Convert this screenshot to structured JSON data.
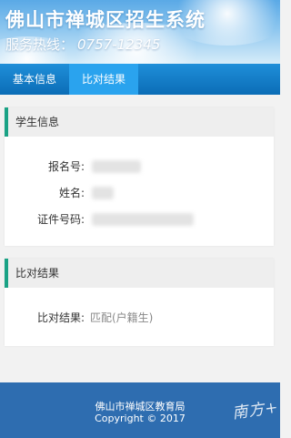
{
  "header": {
    "title": "佛山市禅城区招生系统",
    "hotline_label": "服务热线：",
    "hotline_number": "0757-12345"
  },
  "tabs": [
    {
      "label": "基本信息",
      "active": false
    },
    {
      "label": "比对结果",
      "active": true
    }
  ],
  "student_info": {
    "heading": "学生信息",
    "fields": [
      {
        "label": "报名号:",
        "value": ""
      },
      {
        "label": "姓名:",
        "value": ""
      },
      {
        "label": "证件号码:",
        "value": ""
      }
    ]
  },
  "compare": {
    "heading": "比对结果",
    "label": "比对结果:",
    "value": "匹配(户籍生)"
  },
  "footer": {
    "org": "佛山市禅城区教育局",
    "copyright": "Copyright © 2017"
  },
  "watermark": "南方+",
  "colors": {
    "tab_bar": "#0b6db6",
    "tab_active": "#2aa3ee",
    "section_accent": "#1aa285",
    "footer": "#2e6db0"
  }
}
